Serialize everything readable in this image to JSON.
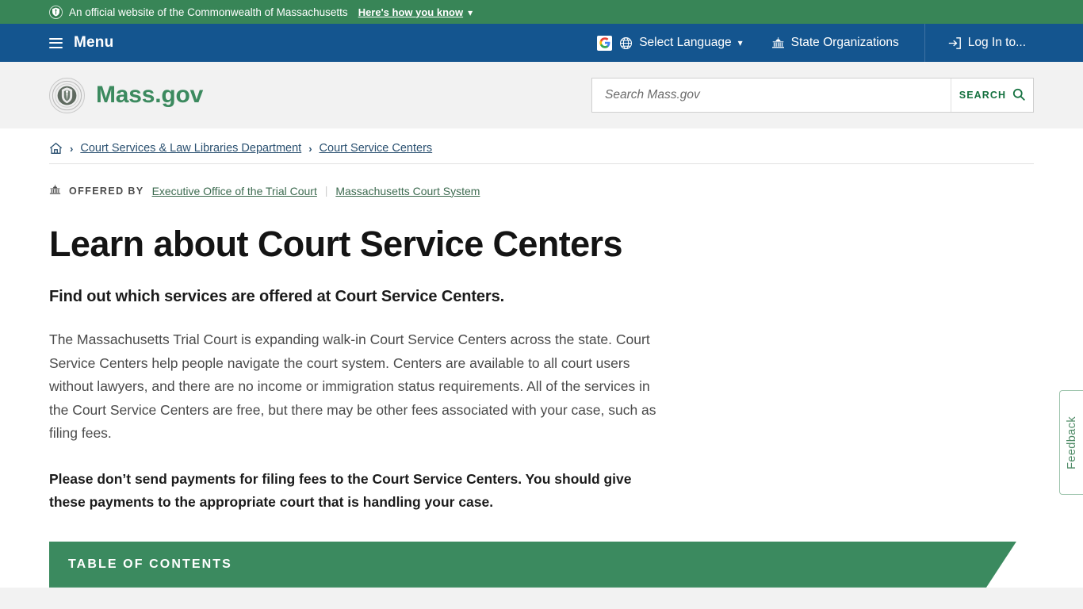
{
  "official_banner": {
    "seal_icon": "shield-seal-icon",
    "text": "An official website of the Commonwealth of Massachusetts",
    "howto_label": "Here's how you know",
    "caret": "⌄"
  },
  "utility_nav": {
    "menu_label": "Menu",
    "menu_icon": "hamburger-icon",
    "items": [
      {
        "label": "Select Language",
        "icon": "globe-icon",
        "leading_icon": "google-g-icon",
        "caret": "⌄"
      },
      {
        "label": "State Organizations",
        "icon": "capitol-icon"
      },
      {
        "label": "Log In to...",
        "icon": "login-arrow-icon"
      }
    ]
  },
  "brand": {
    "name": "Mass.gov",
    "seal_icon": "state-seal-icon"
  },
  "search": {
    "placeholder": "Search Mass.gov",
    "value": "",
    "button_label": "SEARCH",
    "button_icon": "magnifier-icon"
  },
  "breadcrumb": {
    "home_icon": "home-icon",
    "separator": "›",
    "items": [
      {
        "label": "Court Services & Law Libraries Department"
      },
      {
        "label": "Court Service Centers"
      }
    ]
  },
  "offered_by": {
    "icon": "capitol-icon",
    "label": "OFFERED BY",
    "separator": "|",
    "organizations": [
      {
        "label": "Executive Office of the Trial Court"
      },
      {
        "label": "Massachusetts Court System"
      }
    ]
  },
  "main": {
    "title": "Learn about Court Service Centers",
    "lede": "Find out which services are offered at Court Service Centers.",
    "paragraph_1": "The Massachusetts Trial Court is expanding walk-in Court Service Centers across the state. Court Service Centers help people navigate the court system. Centers are available to all court users without lawyers, and there are no income or immigration status requirements. All of the services in the Court Service Centers are free, but there may be other fees associated with your case, such as filing fees.",
    "paragraph_2": "Please don’t send payments for filing fees to the Court Service Centers. You should give these payments to the appropriate court that is handling your case."
  },
  "table_of_contents": {
    "title": "TABLE OF CONTENTS"
  },
  "feedback": {
    "label": "Feedback"
  },
  "colors": {
    "banner_green": "#388557",
    "nav_blue": "#14558f",
    "brand_green": "#3c8a5f",
    "toc_green": "#3b8a5f",
    "link_blue": "#2a5070",
    "link_green": "#3d6b50",
    "page_bg": "#f2f2f2"
  }
}
